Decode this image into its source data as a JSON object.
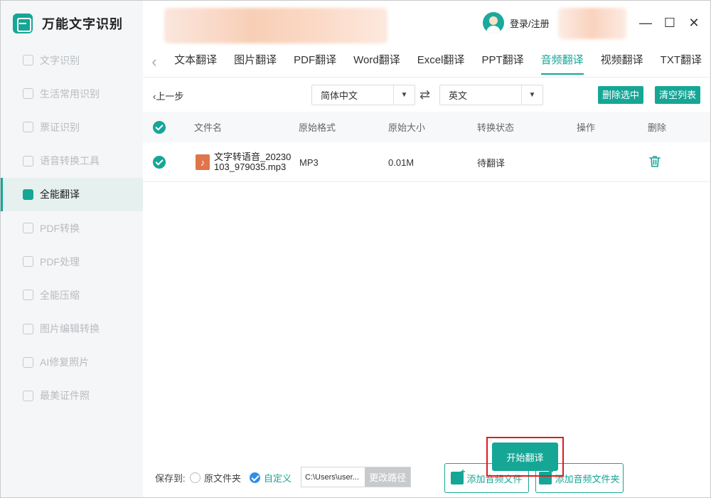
{
  "app": {
    "name": "万能文字识别",
    "login_label": "登录/注册",
    "colors": {
      "accent": "#16a696",
      "highlight_border": "#e01b1b",
      "sidebar_bg": "#f5f6f7"
    }
  },
  "window_controls": {
    "minimize": "—",
    "maximize": "☐",
    "close": "✕"
  },
  "sidebar": {
    "items": [
      {
        "label": "文字识别",
        "icon": "scan-text-icon",
        "active": false
      },
      {
        "label": "生活常用识别",
        "icon": "scan-life-icon",
        "active": false
      },
      {
        "label": "票证识别",
        "icon": "ticket-scan-icon",
        "active": false
      },
      {
        "label": "语音转换工具",
        "icon": "voice-convert-icon",
        "active": false
      },
      {
        "label": "全能翻译",
        "icon": "translate-icon",
        "active": true
      },
      {
        "label": "PDF转换",
        "icon": "pdf-convert-icon",
        "active": false
      },
      {
        "label": "PDF处理",
        "icon": "pdf-process-icon",
        "active": false
      },
      {
        "label": "全能压缩",
        "icon": "compress-icon",
        "active": false
      },
      {
        "label": "图片编辑转换",
        "icon": "image-edit-icon",
        "active": false
      },
      {
        "label": "AI修复照片",
        "icon": "ai-repair-icon",
        "active": false
      },
      {
        "label": "最美证件照",
        "icon": "id-photo-icon",
        "active": false
      }
    ]
  },
  "tabs": {
    "back_icon": "‹",
    "items": [
      {
        "label": "文本翻译",
        "active": false
      },
      {
        "label": "图片翻译",
        "active": false
      },
      {
        "label": "PDF翻译",
        "active": false
      },
      {
        "label": "Word翻译",
        "active": false
      },
      {
        "label": "Excel翻译",
        "active": false
      },
      {
        "label": "PPT翻译",
        "active": false
      },
      {
        "label": "音频翻译",
        "active": true
      },
      {
        "label": "视频翻译",
        "active": false
      },
      {
        "label": "TXT翻译",
        "active": false
      }
    ]
  },
  "toolbar": {
    "back_label": "上一步",
    "source_lang": "简体中文",
    "target_lang": "英文",
    "swap_icon": "⇄",
    "caret": "▼",
    "delete_selected": "删除选中",
    "clear_list": "清空列表"
  },
  "table": {
    "headers": {
      "filename": "文件名",
      "format": "原始格式",
      "size": "原始大小",
      "status": "转换状态",
      "action": "操作",
      "delete": "删除"
    },
    "rows": [
      {
        "checked": true,
        "filename": "文字转语音_20230103_979035.mp3",
        "format": "MP3",
        "size": "0.01M",
        "status": "待翻译",
        "action": "",
        "file_icon": "♪"
      }
    ]
  },
  "footer": {
    "save_to_label": "保存到:",
    "option_original": "原文件夹",
    "option_custom": "自定义",
    "selected_option": "自定义",
    "path_value": "C:\\Users\\user...",
    "change_path": "更改路径",
    "add_audio_file": "添加音频文件",
    "add_audio_folder": "添加音频文件夹",
    "start_translate": "开始翻译"
  }
}
